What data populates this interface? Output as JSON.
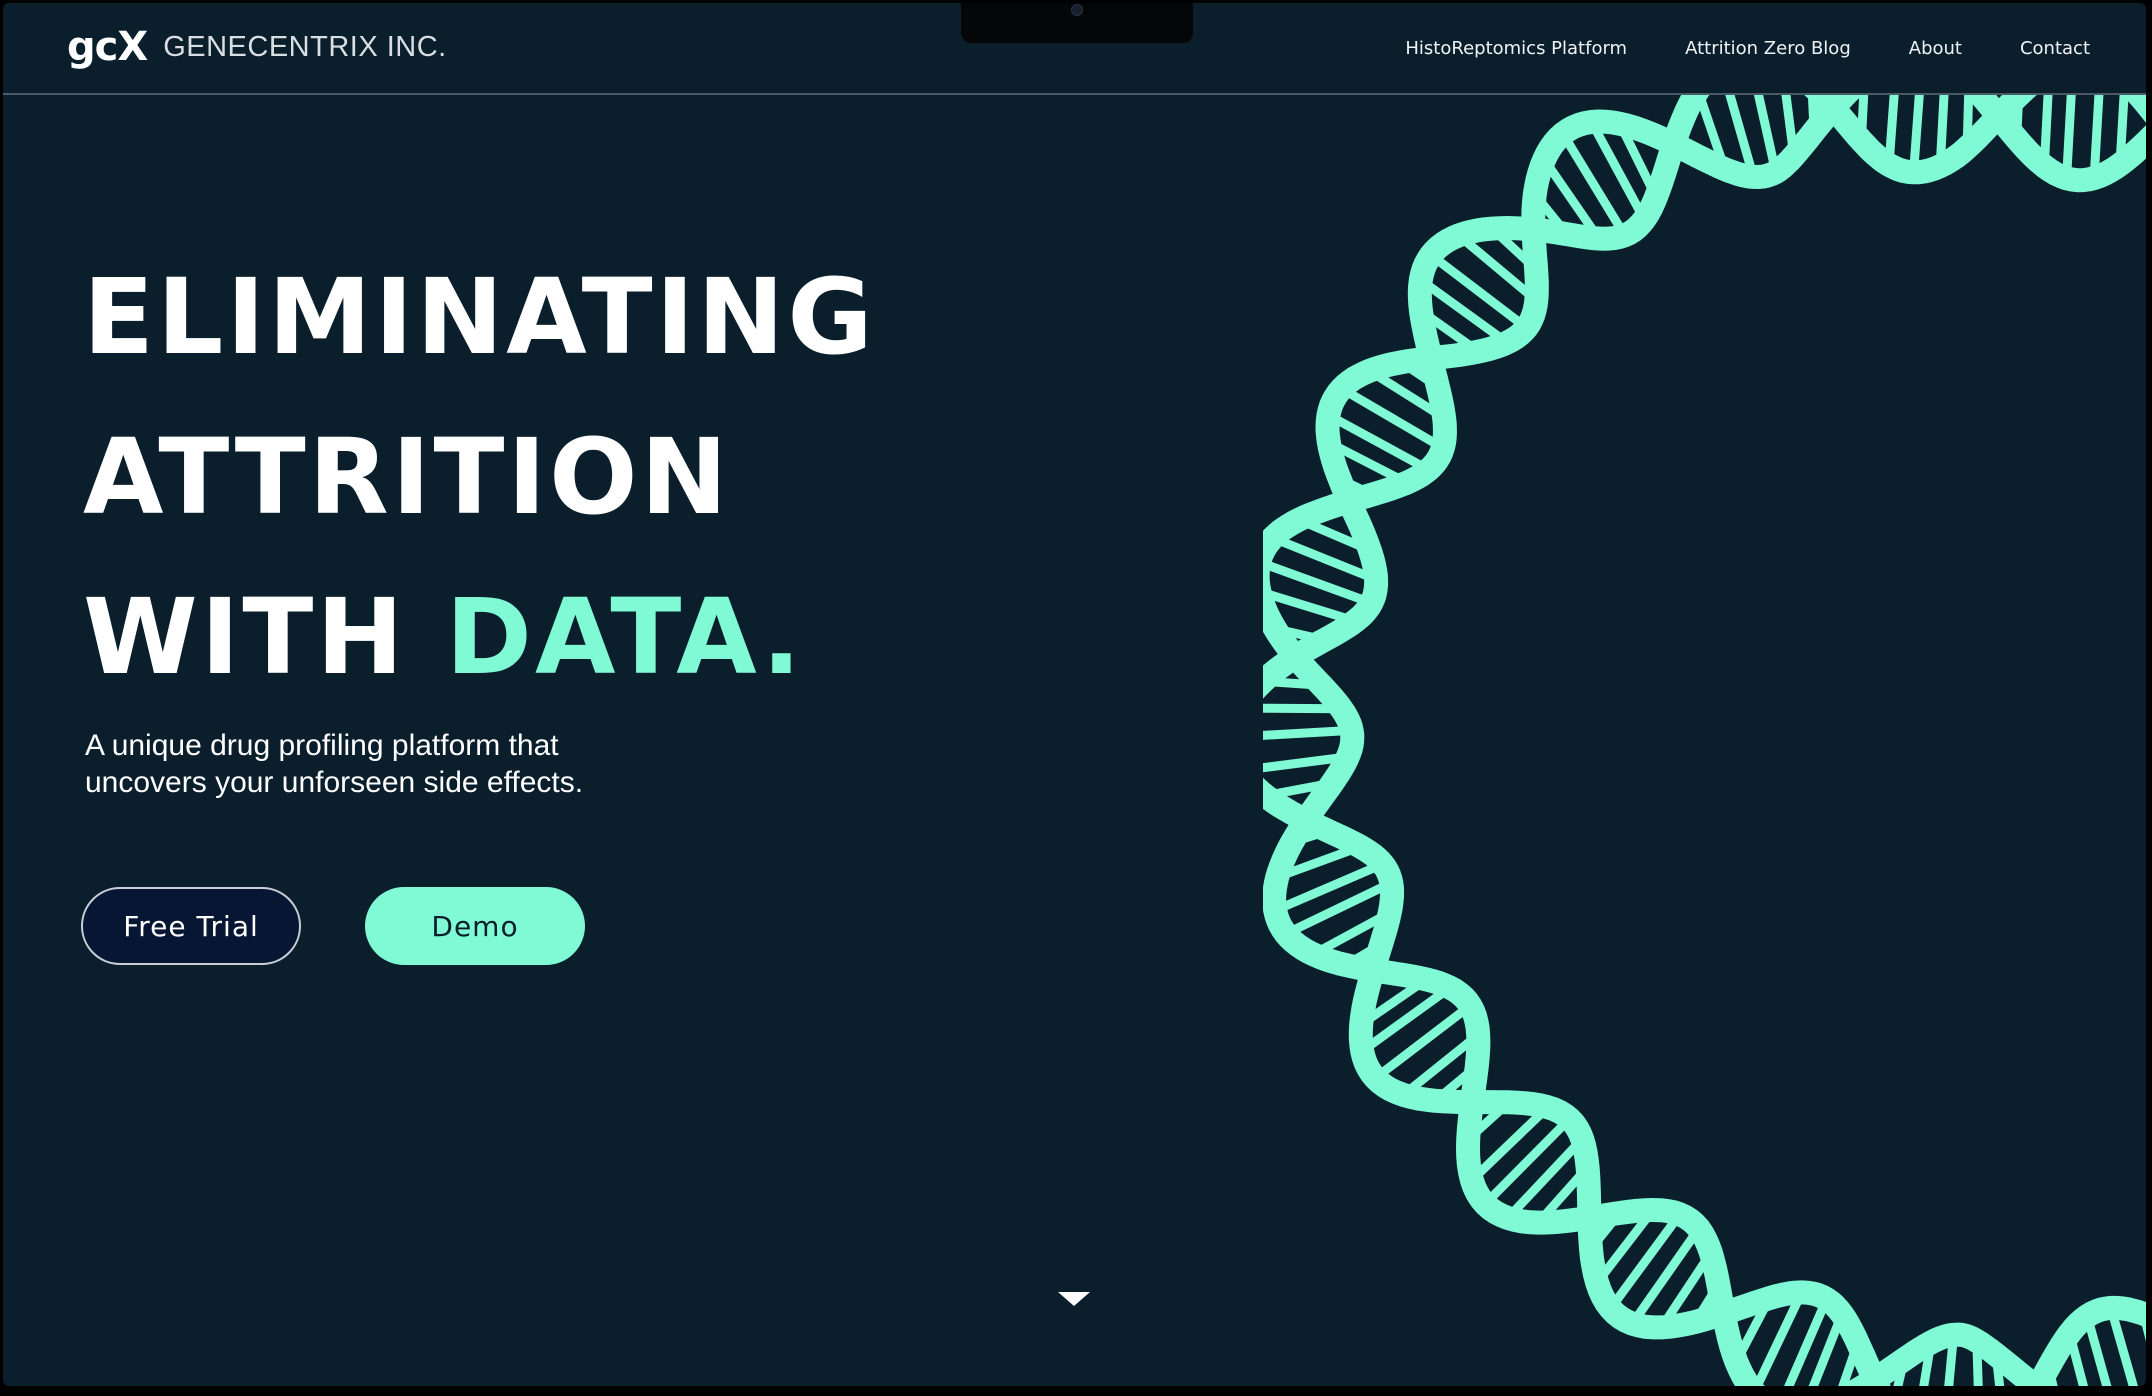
{
  "brand": {
    "logo_mark": "gcX",
    "name": "GENECENTRIX INC."
  },
  "nav": {
    "items": [
      {
        "label": "HistoReptomics Platform"
      },
      {
        "label": "Attrition Zero Blog"
      },
      {
        "label": "About"
      },
      {
        "label": "Contact"
      }
    ]
  },
  "hero": {
    "headline_line1": "ELIMINATING",
    "headline_line2": "ATTRITION",
    "headline_line3_a": "WITH ",
    "headline_line3_b": "DATA.",
    "subtitle_line1": "A unique drug profiling platform that",
    "subtitle_line2": "uncovers your unforseen side effects.",
    "buttons": {
      "trial_label": "Free Trial",
      "demo_label": "Demo"
    },
    "illustration": "dna-helix"
  },
  "colors": {
    "background": "#0a1e2c",
    "accent": "#7ffad4",
    "trial_button_bg": "#071733",
    "text": "#ffffff"
  },
  "icons": {
    "scroll": "chevron-down-icon",
    "camera": "camera-icon"
  }
}
